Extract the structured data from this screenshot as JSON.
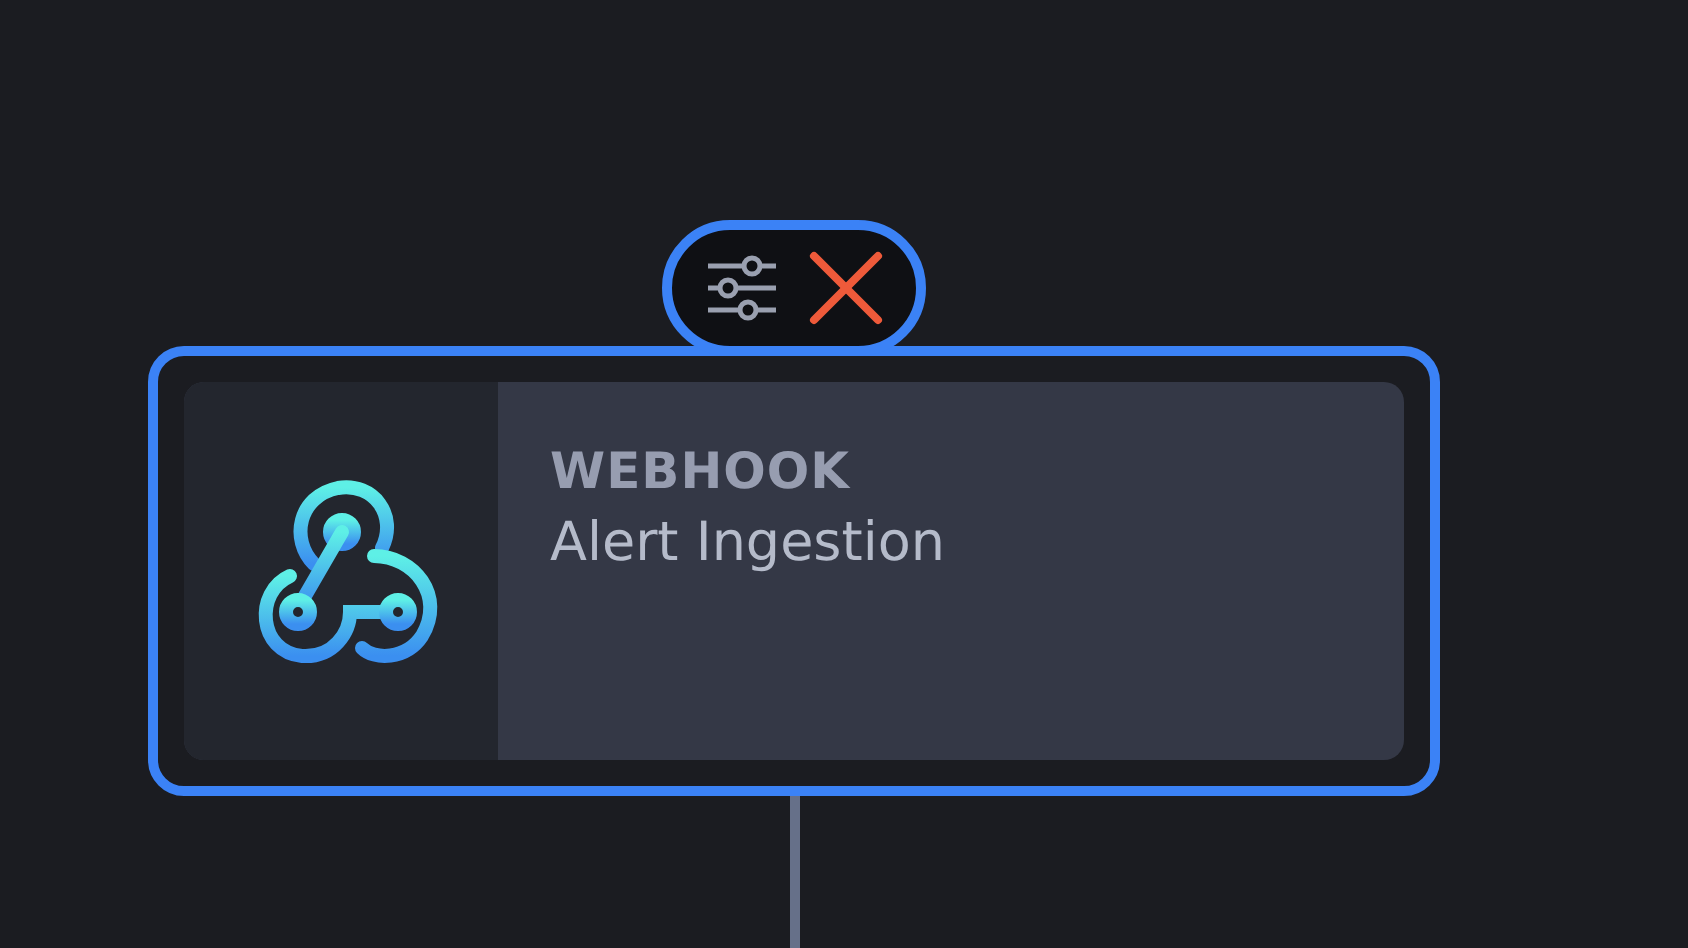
{
  "node": {
    "type": "WEBHOOK",
    "title": "Alert Ingestion",
    "selected": true
  }
}
